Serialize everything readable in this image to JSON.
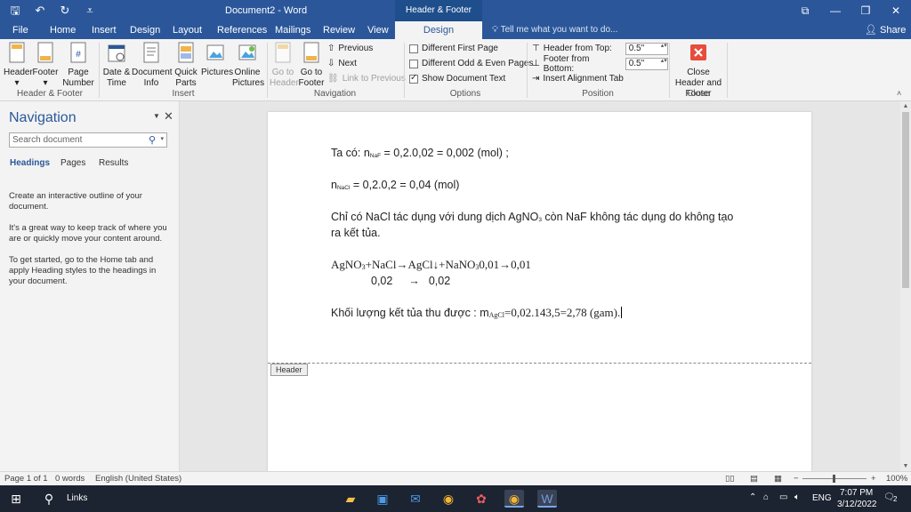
{
  "titlebar": {
    "title": "Document2 - Word",
    "context_group": "Header & Footer Tools",
    "qat": [
      "save-icon",
      "undo-icon",
      "redo-icon",
      "customize-icon"
    ]
  },
  "tabs": {
    "file": "File",
    "home": "Home",
    "insert": "Insert",
    "design": "Design",
    "layout": "Layout",
    "references": "References",
    "mailings": "Mailings",
    "review": "Review",
    "view": "View",
    "hf_design": "Design",
    "tell_me": "Tell me what you want to do...",
    "share": "Share"
  },
  "ribbon": {
    "header": "Header",
    "footer": "Footer",
    "page_number": "Page Number",
    "group_hf": "Header & Footer",
    "date_time": "Date & Time",
    "document_info": "Document Info",
    "quick_parts": "Quick Parts",
    "pictures": "Pictures",
    "online_pictures": "Online Pictures",
    "group_insert": "Insert",
    "go_to_header": "Go to Header",
    "go_to_footer": "Go to Footer",
    "previous": "Previous",
    "next": "Next",
    "link_to_previous": "Link to Previous",
    "group_navigation": "Navigation",
    "different_first_page": "Different First Page",
    "different_odd_even": "Different Odd & Even Pages",
    "show_document_text": "Show Document Text",
    "group_options": "Options",
    "header_from_top": "Header from Top:",
    "header_from_top_value": "0.5\"",
    "footer_from_bottom": "Footer from Bottom:",
    "footer_from_bottom_value": "0.5\"",
    "insert_alignment_tab": "Insert Alignment Tab",
    "group_position": "Position",
    "close_header_footer": "Close Header and Footer",
    "group_close": "Close",
    "accent_close": "#e74c3c"
  },
  "navigation": {
    "title": "Navigation",
    "search_placeholder": "Search document",
    "tab_headings": "Headings",
    "tab_pages": "Pages",
    "tab_results": "Results",
    "help_1": "Create an interactive outline of your document.",
    "help_2": "It's a great way to keep track of where you are or quickly move your content around.",
    "help_3": "To get started, go to the Home tab and apply Heading styles to the headings in your document."
  },
  "document": {
    "l1_pre": "Ta có: n",
    "l1_sub": "NaF",
    "l1_post": " = 0,2.0,02 = 0,002 (mol) ;",
    "l2_pre": "n",
    "l2_sub": "NaCl",
    "l2_post": " = 0,2.0,2 = 0,04 (mol)",
    "l3a_pre": "Chỉ có NaCl tác dụng với dung dịch AgNO",
    "l3a_sub": "3",
    "l3a_post": " còn NaF không tác dụng do không tạo",
    "l3b": "ra kết tủa.",
    "eq_a": "AgNO",
    "eq_a_sub": "3",
    "eq_b": "+NaCl→AgCl↓+NaNO",
    "eq_b_sub": "3",
    "eq_c": "0,01→0,01",
    "eq2_left": "0,02",
    "eq2_arrow": "→",
    "eq2_right": "0,02",
    "l5_pre": "Khối lượng kết tủa thu được : m",
    "l5_sub": "AgCl",
    "l5_post": "=0,02.143,5=2,78 (gam).",
    "header_tag": "Header"
  },
  "statusbar": {
    "page": "Page 1 of 1",
    "words": "0 words",
    "language": "English (United States)",
    "zoom": "100%"
  },
  "taskbar": {
    "search_label": "Links",
    "lang": "ENG",
    "time": "7:07 PM",
    "date": "3/12/2022",
    "notifications": "2"
  }
}
